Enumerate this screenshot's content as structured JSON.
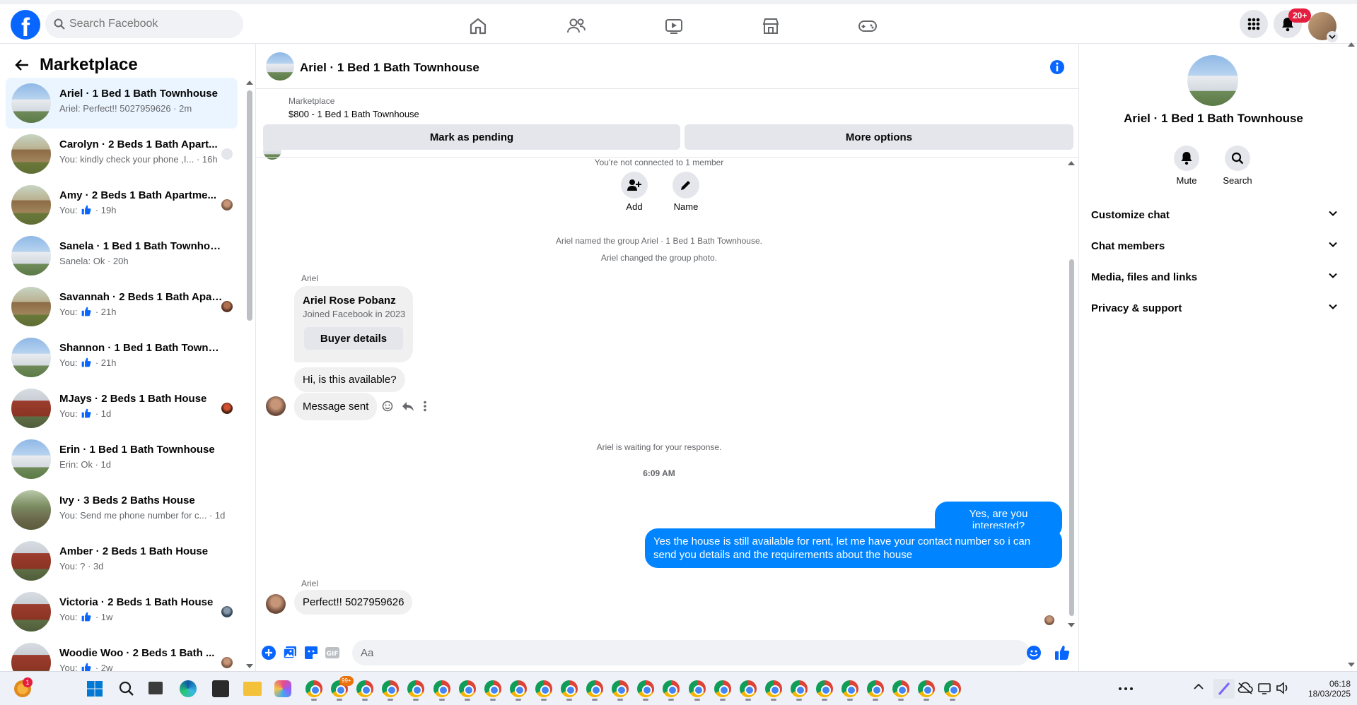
{
  "topnav": {
    "search_placeholder": "Search Facebook",
    "notif_badge": "20+"
  },
  "sidebar": {
    "title": "Marketplace",
    "conversations": [
      {
        "name": "Ariel · 1 Bed 1 Bath Townhouse",
        "preview": "Ariel: Perfect!! 5027959626 · 2m",
        "thumb": "blue",
        "active": true,
        "seen": ""
      },
      {
        "name": "Carolyn · 2 Beds 1 Bath Apart...",
        "preview": "You: kindly check your phone ,I... · 16h",
        "thumb": "brown",
        "seen": "gray"
      },
      {
        "name": "Amy · 2 Beds 1 Bath Apartme...",
        "preview_prefix": "You:",
        "preview": "· 19h",
        "thumb": "brown",
        "like": true,
        "seen": "p1"
      },
      {
        "name": "Sanela · 1 Bed 1 Bath Townhouse",
        "preview": "Sanela: Ok · 20h",
        "thumb": "blue",
        "seen": ""
      },
      {
        "name": "Savannah · 2 Beds 1 Bath Apar...",
        "preview_prefix": "You:",
        "preview": "· 21h",
        "thumb": "brown",
        "like": true,
        "seen": "p2"
      },
      {
        "name": "Shannon · 1 Bed 1 Bath Townhou...",
        "preview_prefix": "You:",
        "preview": "· 21h",
        "thumb": "blue",
        "like": true,
        "seen": ""
      },
      {
        "name": "MJays · 2 Beds 1 Bath House",
        "preview_prefix": "You:",
        "preview": "· 1d",
        "thumb": "red",
        "like": true,
        "seen": "p3"
      },
      {
        "name": "Erin · 1 Bed 1 Bath Townhouse",
        "preview": "Erin: Ok · 1d",
        "thumb": "blue",
        "seen": ""
      },
      {
        "name": "Ivy · 3 Beds 2 Baths House",
        "preview": "You: Send me phone number for c... · 1d",
        "thumb": "tree",
        "seen": ""
      },
      {
        "name": "Amber · 2 Beds 1 Bath House",
        "preview": "You: ? · 3d",
        "thumb": "red",
        "seen": ""
      },
      {
        "name": "Victoria · 2 Beds 1 Bath House",
        "preview_prefix": "You:",
        "preview": "· 1w",
        "thumb": "red",
        "like": true,
        "seen": "p4"
      },
      {
        "name": "Woodie Woo · 2 Beds 1 Bath ...",
        "preview_prefix": "You:",
        "preview": "· 2w",
        "thumb": "red",
        "like": true,
        "seen": "p1"
      }
    ]
  },
  "chat": {
    "title": "Ariel · 1 Bed 1 Bath Townhouse",
    "marketplace_label": "Marketplace",
    "listing": "$800 - 1 Bed 1 Bath Townhouse",
    "mark_pending": "Mark as pending",
    "more_options": "More options",
    "not_connected": "You're not connected to 1 member",
    "add_label": "Add",
    "name_label": "Name",
    "sys_named_who": "Ariel",
    "sys_named_rest": "named the group Ariel · 1 Bed 1 Bath Townhouse.",
    "sys_photo_who": "Ariel",
    "sys_photo_rest": "changed the group photo.",
    "sender1": "Ariel",
    "buyer_name": "Ariel Rose Pobanz",
    "buyer_joined": "Joined Facebook in 2023",
    "buyer_details": "Buyer details",
    "msg_available": "Hi, is this available?",
    "msg_sent": "Message sent",
    "sys_waiting_who": "Ariel",
    "sys_waiting_rest": "is waiting for your response.",
    "timestamp": "6:09 AM",
    "my_msg1": "Yes, are you interested?",
    "my_msg2": "Yes the house is still available for rent, let me have your contact number so i can send you details and the requirements about the house",
    "sender2": "Ariel",
    "msg_perfect": "Perfect!! 5027959626",
    "composer_placeholder": "Aa"
  },
  "rpanel": {
    "title": "Ariel · 1 Bed 1 Bath Townhouse",
    "mute": "Mute",
    "search": "Search",
    "sections": [
      "Customize chat",
      "Chat members",
      "Media, files and links",
      "Privacy & support"
    ]
  },
  "taskbar": {
    "time": "06:18",
    "date": "18/03/2025",
    "weather_badge": "1",
    "chrome_badge": "99+"
  }
}
